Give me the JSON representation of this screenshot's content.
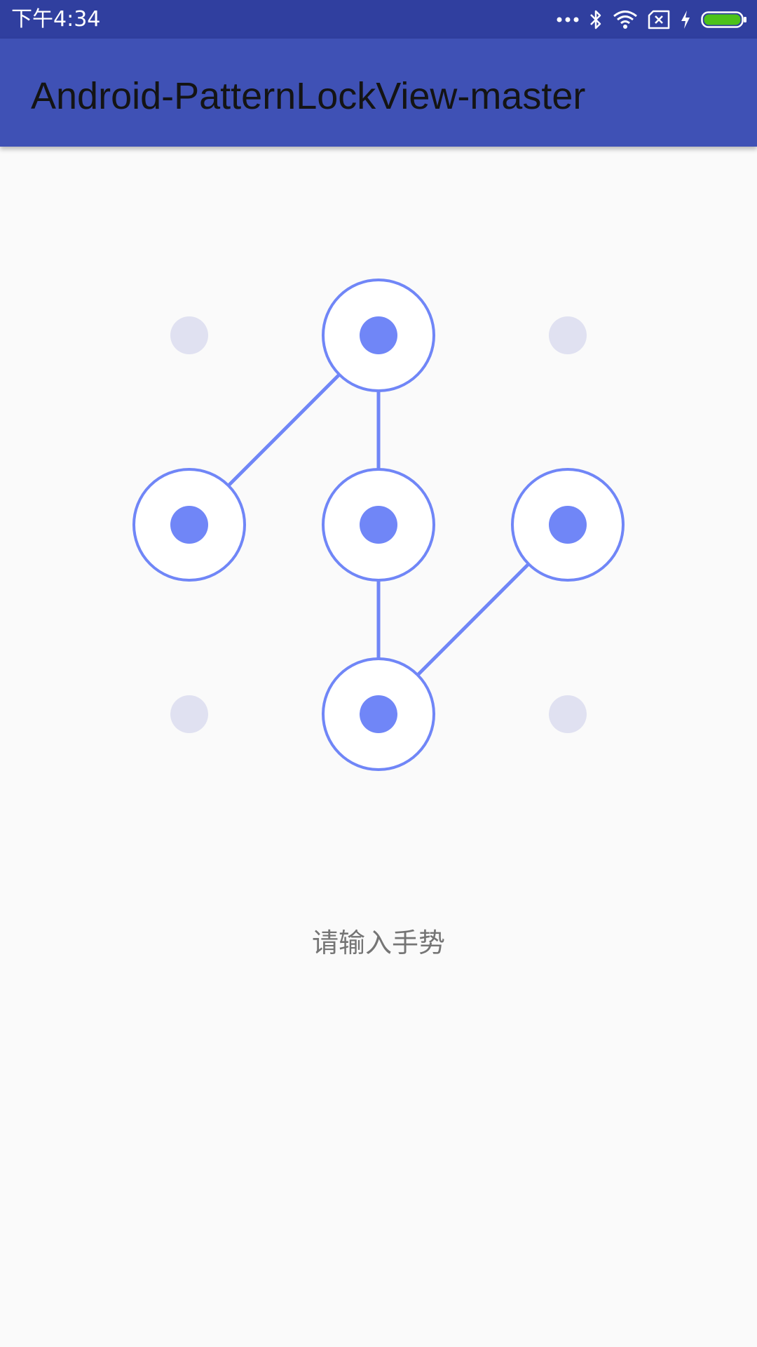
{
  "status_bar": {
    "time": "下午4:34",
    "icons": [
      "more-dots-icon",
      "bluetooth-icon",
      "wifi-icon",
      "sim-error-icon",
      "charging-icon",
      "battery-icon"
    ],
    "battery_color": "#4cc21a"
  },
  "app_bar": {
    "title": "Android-PatternLockView-master",
    "color": "#3f51b5"
  },
  "pattern_lock": {
    "grid": [
      3,
      3
    ],
    "selected_dots": [
      {
        "row": 0,
        "col": 1
      },
      {
        "row": 1,
        "col": 0
      },
      {
        "row": 1,
        "col": 1
      },
      {
        "row": 1,
        "col": 2
      },
      {
        "row": 2,
        "col": 1
      }
    ],
    "path_segments": [
      [
        {
          "row": 1,
          "col": 0
        },
        {
          "row": 0,
          "col": 1
        }
      ],
      [
        {
          "row": 0,
          "col": 1
        },
        {
          "row": 1,
          "col": 1
        }
      ],
      [
        {
          "row": 1,
          "col": 1
        },
        {
          "row": 2,
          "col": 1
        }
      ],
      [
        {
          "row": 2,
          "col": 1
        },
        {
          "row": 1,
          "col": 2
        }
      ]
    ],
    "active_color": "#7086f7",
    "inactive_color": "#e0e1f1"
  },
  "prompt": {
    "text": "请输入手势"
  }
}
